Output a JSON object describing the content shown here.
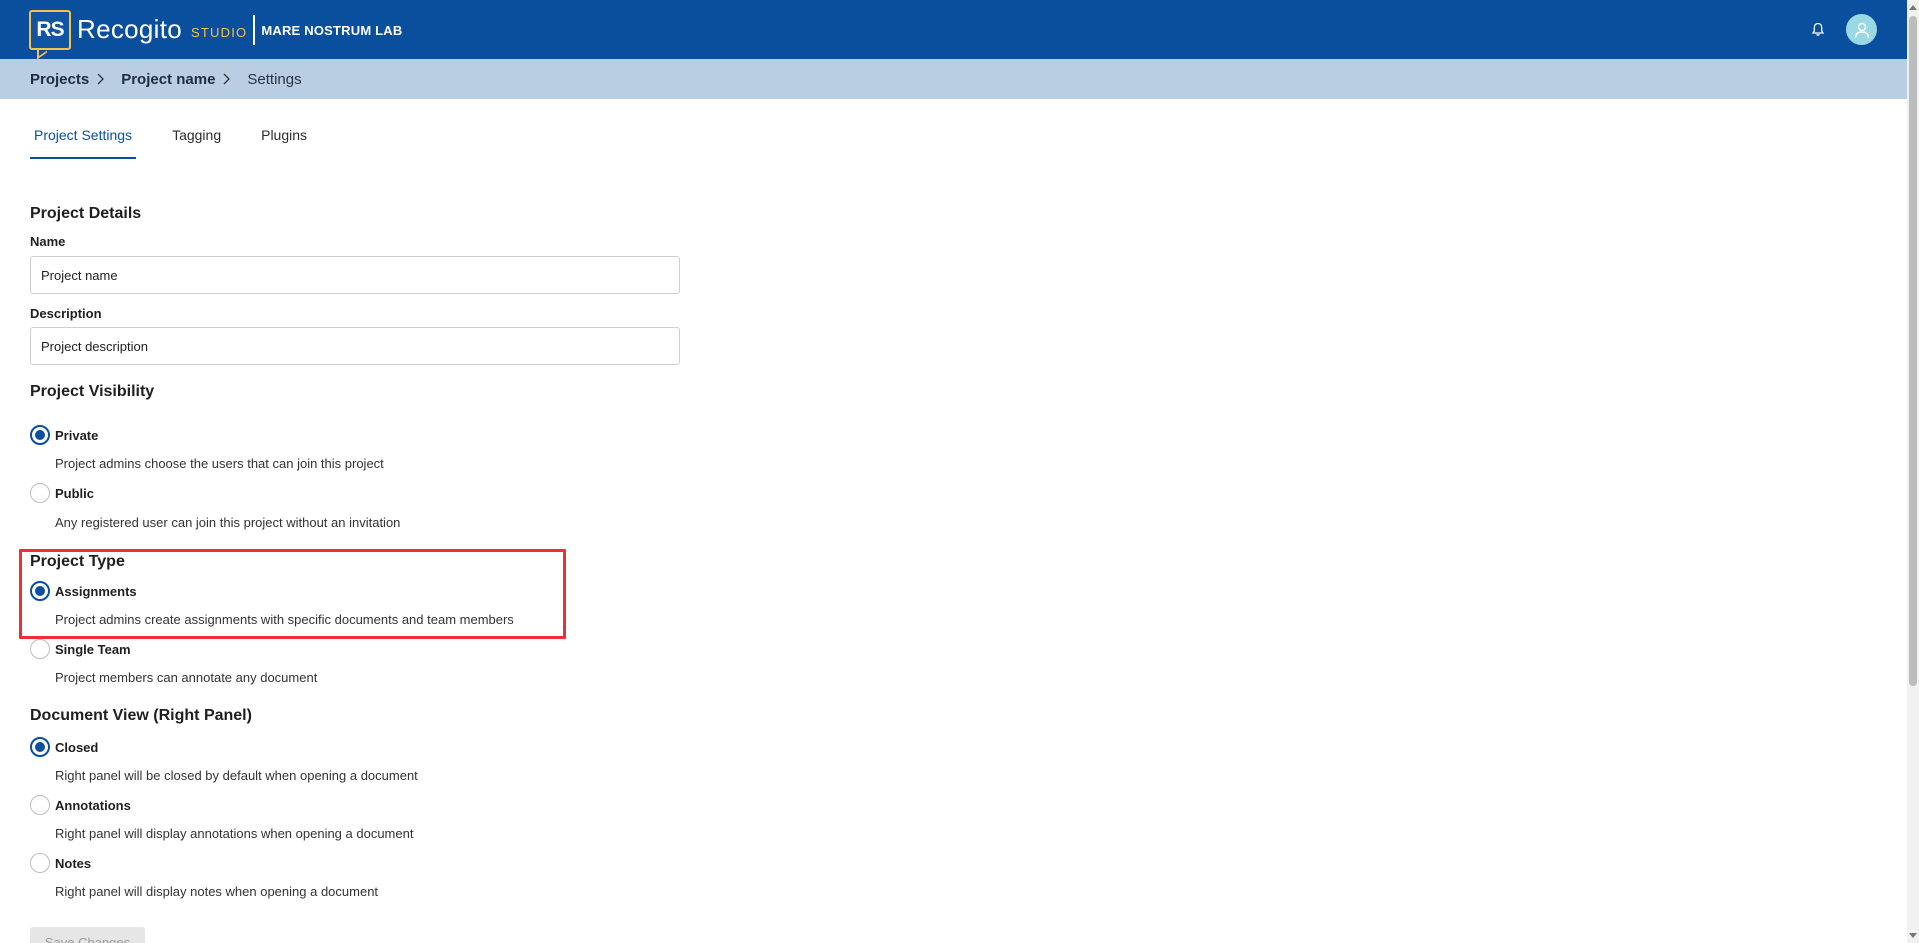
{
  "header": {
    "logo_mark": "RS",
    "app_name": "Recogito",
    "app_suffix": "STUDIO",
    "org_name": "MARE NOSTRUM LAB"
  },
  "breadcrumb": {
    "items": [
      "Projects",
      "Project name"
    ],
    "current": "Settings"
  },
  "tabs": [
    {
      "label": "Project Settings",
      "active": true
    },
    {
      "label": "Tagging",
      "active": false
    },
    {
      "label": "Plugins",
      "active": false
    }
  ],
  "details": {
    "title": "Project Details",
    "name_label": "Name",
    "name_value": "Project name",
    "description_label": "Description",
    "description_value": "Project description"
  },
  "visibility": {
    "title": "Project Visibility",
    "options": [
      {
        "label": "Private",
        "desc": "Project admins choose the users that can join this project",
        "checked": true
      },
      {
        "label": "Public",
        "desc": "Any registered user can join this project without an invitation",
        "checked": false
      }
    ]
  },
  "type": {
    "title": "Project Type",
    "options": [
      {
        "label": "Assignments",
        "desc": "Project admins create assignments with specific documents and team members",
        "checked": true
      },
      {
        "label": "Single Team",
        "desc": "Project members can annotate any document",
        "checked": false
      }
    ]
  },
  "docview": {
    "title": "Document View (Right Panel)",
    "options": [
      {
        "label": "Closed",
        "desc": "Right panel will be closed by default when opening a document",
        "checked": true
      },
      {
        "label": "Annotations",
        "desc": "Right panel will display annotations when opening a document",
        "checked": false
      },
      {
        "label": "Notes",
        "desc": "Right panel will display notes when opening a document",
        "checked": false
      }
    ]
  },
  "save_label": "Save Changes",
  "colors": {
    "brand": "#0a4f9e",
    "accent": "#f2c34b",
    "breadcrumb_bg": "#b9cde3",
    "highlight": "#ef2f38"
  }
}
